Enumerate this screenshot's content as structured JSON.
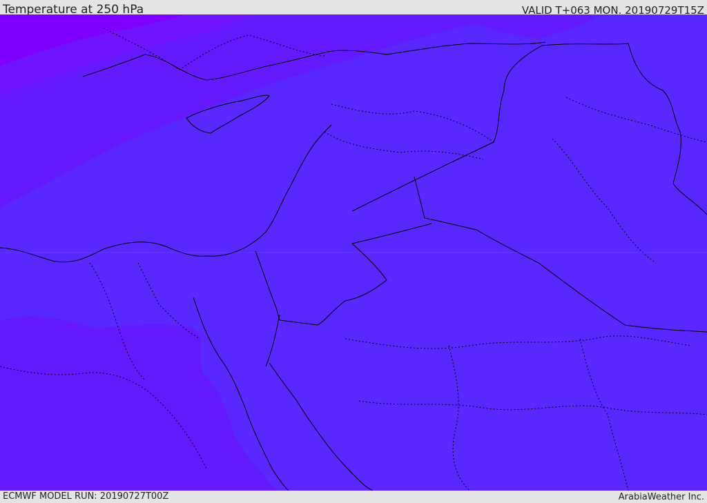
{
  "header": {
    "title": "Temperature at 250 hPa",
    "valid": "VALID T+063 MON. 20190729T15Z"
  },
  "footer": {
    "model_run": "ECMWF MODEL RUN: 20190727T00Z",
    "credit": "ArabiaWeather Inc."
  },
  "colors": {
    "coldest": "#8000ff",
    "cold": "#7014ff",
    "mid": "#6419ff",
    "warm": "#5a28ff",
    "border": "#000000"
  }
}
